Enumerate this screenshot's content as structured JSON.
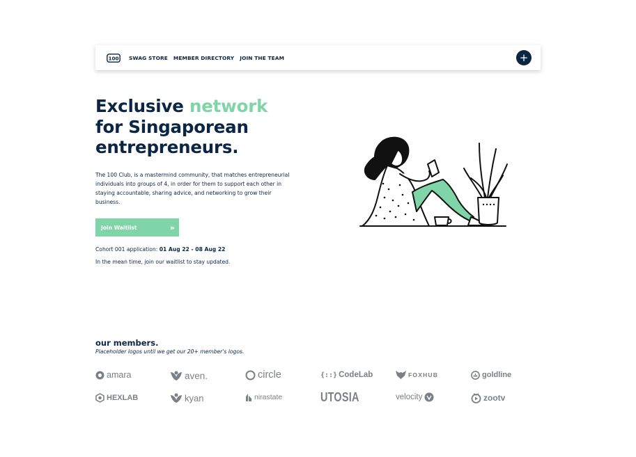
{
  "nav": {
    "logo_text": "100",
    "links": [
      "SWAG STORE",
      "MEMBER DIRECTORY",
      "JOIN THE TEAM"
    ],
    "plus_label": "+"
  },
  "hero": {
    "headline_part1": "Exclusive ",
    "headline_accent": "network",
    "headline_line2": "for Singaporean",
    "headline_line3": "entrepreneurs.",
    "intro": "The 100 Club, is a mastermind community, that matches entrepreneurial individuals into groups of 4, in order for them to support each other in staying accountable, sharing advice, and networking to grow their business.",
    "cta_label": "Join Waitlist",
    "cta_arrow": "»",
    "cohort_label": "Cohort 001 application: ",
    "cohort_dates": "01 Aug 22 - 08 Aug 22",
    "waitlist_note": "In the mean time, join our waitlist to stay updated."
  },
  "members": {
    "title": "our members.",
    "subtitle": "Placeholder logos until we get our 20+ member's logos.",
    "logos": [
      {
        "name": "amara",
        "icon": "amara-icon"
      },
      {
        "name": "aven.",
        "icon": "aven-icon"
      },
      {
        "name": "circle",
        "icon": "circle-icon"
      },
      {
        "name": "CodeLab",
        "prefix": "{::}",
        "icon": "codelab-icon"
      },
      {
        "name": "FOXHUB",
        "icon": "foxhub-icon"
      },
      {
        "name": "goldline",
        "icon": "goldline-icon"
      },
      {
        "name": "HEXLAB",
        "icon": "hexlab-icon"
      },
      {
        "name": "kyan",
        "icon": "kyan-icon"
      },
      {
        "name": "nirastate",
        "icon": "nirastate-icon"
      },
      {
        "name": "UTOSIA",
        "icon": "utosia-wordmark"
      },
      {
        "name": "velocity",
        "icon": "velocity-icon"
      },
      {
        "name": "zootv",
        "icon": "zootv-icon"
      }
    ]
  },
  "colors": {
    "navy": "#0b2545",
    "mint": "#7fd4a8",
    "logo_gray": "#7b7f86"
  }
}
